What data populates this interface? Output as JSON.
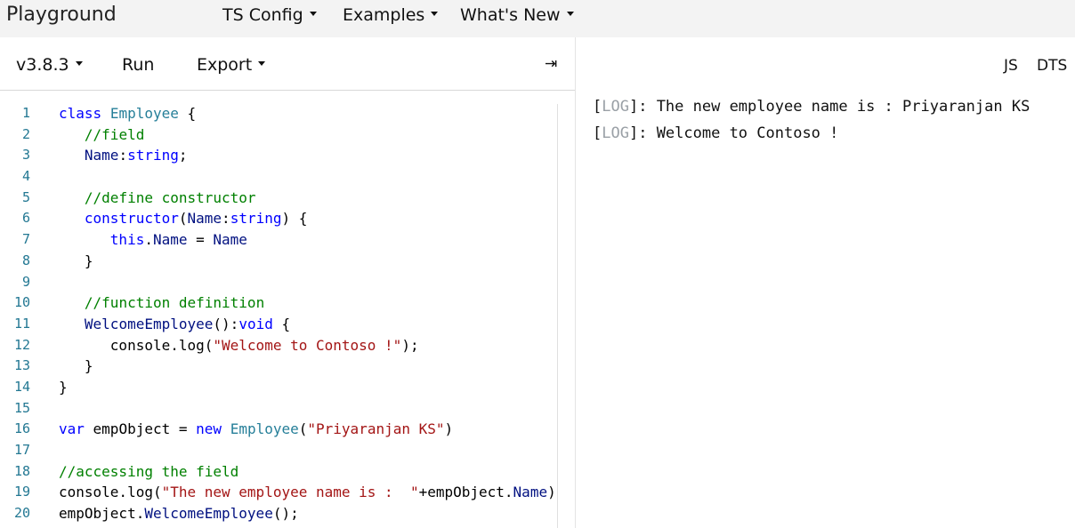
{
  "nav": {
    "brand": "Playground",
    "items": [
      "TS Config",
      "Examples",
      "What's New"
    ]
  },
  "toolbar": {
    "version": "v3.8.3",
    "run": "Run",
    "export": "Export",
    "collapse_icon": "⇥"
  },
  "output_tabs": [
    "JS",
    "DTS"
  ],
  "editor": {
    "line_numbers": [
      "1",
      "2",
      "3",
      "4",
      "5",
      "6",
      "7",
      "8",
      "9",
      "10",
      "11",
      "12",
      "13",
      "14",
      "15",
      "16",
      "17",
      "18",
      "19",
      "20"
    ],
    "lines": [
      "class Employee {",
      "   //field",
      "   Name:string;",
      "",
      "   //define constructor",
      "   constructor(Name:string) {",
      "      this.Name = Name",
      "   }",
      "",
      "   //function definition",
      "   WelcomeEmployee():void {",
      "      console.log(\"Welcome to Contoso !\");",
      "   }",
      "}",
      "",
      "var empObject = new Employee(\"Priyaranjan KS\")",
      "",
      "//accessing the field",
      "console.log(\"The new employee name is :  \"+empObject.Name)",
      "empObject.WelcomeEmployee();"
    ]
  },
  "logs": [
    {
      "tag": "LOG",
      "text": "The new employee name is : Priyaranjan KS"
    },
    {
      "tag": "LOG",
      "text": "Welcome to Contoso !"
    }
  ],
  "colors": {
    "keyword": "#0000ff",
    "type": "#267f99",
    "comment": "#008000",
    "string": "#a31515",
    "line_number": "#237893"
  }
}
